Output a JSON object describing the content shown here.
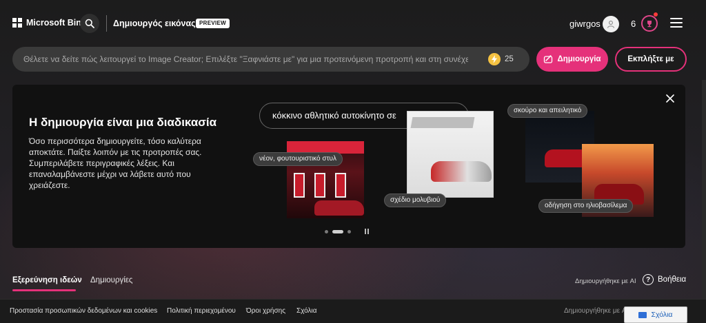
{
  "header": {
    "brand": "Microsoft Bing",
    "app_title": "Δημιουργός εικόνας",
    "badge": "PREVIEW",
    "username": "giwrgos",
    "rewards_count": "6"
  },
  "prompt": {
    "placeholder": "Θέλετε να δείτε πώς λειτουργεί το Image Creator; Επιλέξτε \"Ξαφνιάστε με\" για μια προτεινόμενη προτροπή και στη συνέχεια επιλέξτε \"Δημιουργία\"",
    "boosts": "25",
    "create_label": "Δημιουργία",
    "surprise_label": "Εκπλήξτε με"
  },
  "banner": {
    "title": "Η δημιουργία είναι μια διαδικασία",
    "description": "Όσο περισσότερα δημιουργείτε, τόσο καλύτερα αποκτάτε. Παίξτε λοιπόν με τις προτροπές σας. Συμπεριλάβετε περιγραφικές λέξεις. Και επαναλαμβάνεστε μέχρι να λάβετε αυτό που χρειάζεστε.",
    "prompt_example": "κόκκινο αθλητικό αυτοκίνητο σε",
    "tags": {
      "futuristic": "νέον, φουτουριστικό στυλ",
      "pencil": "σχέδιο μολυβιού",
      "dark": "σκούρο και απειλητικό",
      "sunset": "οδήγηση στο ηλιοβασίλεμα"
    }
  },
  "tabs": {
    "explore": "Εξερεύνηση ιδεών",
    "creations": "Δημιουργίες",
    "ai_note": "Δημιουργήθηκε με AI",
    "help": "Βοήθεια"
  },
  "footer": {
    "links": [
      "Προστασία προσωπικών δεδομένων και cookies",
      "Πολιτική περιεχομένου",
      "Όροι χρήσης",
      "Σχόλια"
    ],
    "ai_note": "Δημιουργήθηκε με AI",
    "feedback": "Σχόλια"
  },
  "colors": {
    "accent": "#e5317a",
    "boost": "#f5c242"
  }
}
